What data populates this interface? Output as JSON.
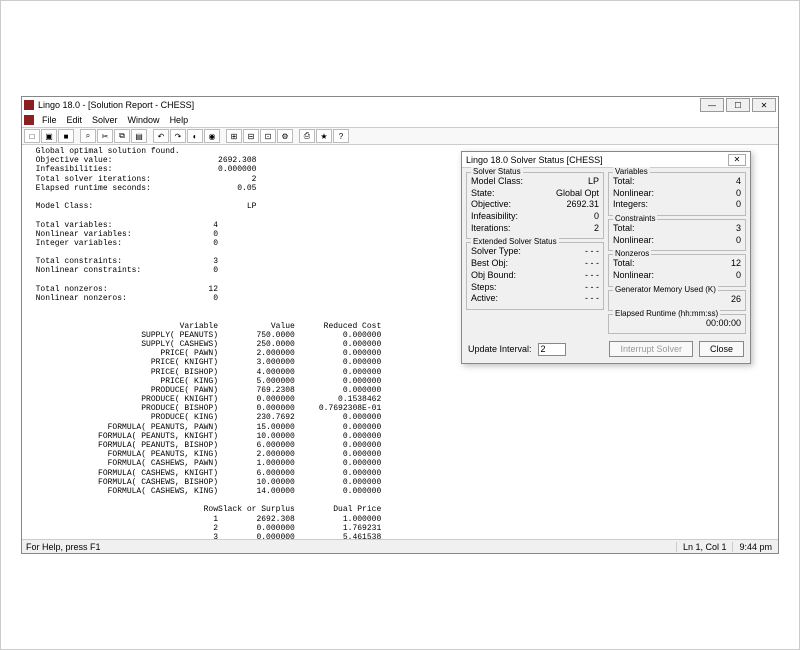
{
  "window": {
    "title": "Lingo 18.0 - [Solution Report - CHESS]",
    "min": "—",
    "max": "☐",
    "close": "✕"
  },
  "menu": [
    "File",
    "Edit",
    "Solver",
    "Window",
    "Help"
  ],
  "toolbar_icons": [
    "□",
    "▣",
    "■",
    "⌕",
    "✂",
    "⧉",
    "▤",
    "↶",
    "↷",
    "◐",
    "◉",
    "⊞",
    "⊟",
    "⊡",
    "⚙",
    "⎙",
    "★",
    "?"
  ],
  "status": {
    "help": "For Help, press F1",
    "pos": "Ln 1, Col 1",
    "time": "9:44 pm"
  },
  "report": {
    "header": "  Global optimal solution found.",
    "summary": [
      {
        "k": "  Objective value:",
        "v": "2692.308"
      },
      {
        "k": "  Infeasibilities:",
        "v": "0.000000"
      },
      {
        "k": "  Total solver iterations:",
        "v": "2"
      },
      {
        "k": "  Elapsed runtime seconds:",
        "v": "0.05"
      }
    ],
    "model_class_k": "  Model Class:",
    "model_class_v": "LP",
    "counts1": [
      {
        "k": "  Total variables:",
        "v": "4"
      },
      {
        "k": "  Nonlinear variables:",
        "v": "0"
      },
      {
        "k": "  Integer variables:",
        "v": "0"
      }
    ],
    "counts2": [
      {
        "k": "  Total constraints:",
        "v": "3"
      },
      {
        "k": "  Nonlinear constraints:",
        "v": "0"
      }
    ],
    "counts3": [
      {
        "k": "  Total nonzeros:",
        "v": "12"
      },
      {
        "k": "  Nonlinear nonzeros:",
        "v": "0"
      }
    ],
    "var_header": {
      "c1": "Variable",
      "c2": "Value",
      "c3": "Reduced Cost"
    },
    "vars": [
      {
        "n": "SUPPLY( PEANUTS)",
        "v": "750.0000",
        "r": "0.000000"
      },
      {
        "n": "SUPPLY( CASHEWS)",
        "v": "250.0000",
        "r": "0.000000"
      },
      {
        "n": "PRICE( PAWN)",
        "v": "2.000000",
        "r": "0.000000"
      },
      {
        "n": "PRICE( KNIGHT)",
        "v": "3.000000",
        "r": "0.000000"
      },
      {
        "n": "PRICE( BISHOP)",
        "v": "4.000000",
        "r": "0.000000"
      },
      {
        "n": "PRICE( KING)",
        "v": "5.000000",
        "r": "0.000000"
      },
      {
        "n": "PRODUCE( PAWN)",
        "v": "769.2308",
        "r": "0.000000"
      },
      {
        "n": "PRODUCE( KNIGHT)",
        "v": "0.000000",
        "r": "0.1538462"
      },
      {
        "n": "PRODUCE( BISHOP)",
        "v": "0.000000",
        "r": "0.7692308E-01"
      },
      {
        "n": "PRODUCE( KING)",
        "v": "230.7692",
        "r": "0.000000"
      },
      {
        "n": "FORMULA( PEANUTS, PAWN)",
        "v": "15.00000",
        "r": "0.000000"
      },
      {
        "n": "FORMULA( PEANUTS, KNIGHT)",
        "v": "10.00000",
        "r": "0.000000"
      },
      {
        "n": "FORMULA( PEANUTS, BISHOP)",
        "v": "6.000000",
        "r": "0.000000"
      },
      {
        "n": "FORMULA( PEANUTS, KING)",
        "v": "2.000000",
        "r": "0.000000"
      },
      {
        "n": "FORMULA( CASHEWS, PAWN)",
        "v": "1.000000",
        "r": "0.000000"
      },
      {
        "n": "FORMULA( CASHEWS, KNIGHT)",
        "v": "6.000000",
        "r": "0.000000"
      },
      {
        "n": "FORMULA( CASHEWS, BISHOP)",
        "v": "10.00000",
        "r": "0.000000"
      },
      {
        "n": "FORMULA( CASHEWS, KING)",
        "v": "14.00000",
        "r": "0.000000"
      }
    ],
    "row_header": {
      "c1": "Row",
      "c2": "Slack or Surplus",
      "c3": "Dual Price"
    },
    "rows": [
      {
        "n": "1",
        "v": "2692.308",
        "r": "1.000000"
      },
      {
        "n": "2",
        "v": "0.000000",
        "r": "1.769231"
      },
      {
        "n": "3",
        "v": "0.000000",
        "r": "5.461538"
      }
    ]
  },
  "dialog": {
    "title": "Lingo 18.0 Solver Status [CHESS]",
    "close": "✕",
    "solver_status_label": "Solver Status",
    "solver_status": [
      {
        "k": "Model Class:",
        "v": "LP"
      },
      {
        "k": "State:",
        "v": "Global Opt"
      },
      {
        "k": "Objective:",
        "v": "2692.31"
      },
      {
        "k": "Infeasibility:",
        "v": "0"
      },
      {
        "k": "Iterations:",
        "v": "2"
      }
    ],
    "ext_label": "Extended Solver Status",
    "ext": [
      {
        "k": "Solver Type:",
        "v": "- - -"
      },
      {
        "k": "Best Obj:",
        "v": "- - -"
      },
      {
        "k": "Obj Bound:",
        "v": "- - -"
      },
      {
        "k": "Steps:",
        "v": "- - -"
      },
      {
        "k": "Active:",
        "v": "- - -"
      }
    ],
    "vars_label": "Variables",
    "vars": [
      {
        "k": "Total:",
        "v": "4"
      },
      {
        "k": "Nonlinear:",
        "v": "0"
      },
      {
        "k": "Integers:",
        "v": "0"
      }
    ],
    "cons_label": "Constraints",
    "cons": [
      {
        "k": "Total:",
        "v": "3"
      },
      {
        "k": "Nonlinear:",
        "v": "0"
      }
    ],
    "nz_label": "Nonzeros",
    "nz": [
      {
        "k": "Total:",
        "v": "12"
      },
      {
        "k": "Nonlinear:",
        "v": "0"
      }
    ],
    "mem_label": "Generator Memory Used (K)",
    "mem_value": "26",
    "rt_label": "Elapsed Runtime (hh:mm:ss)",
    "rt_value": "00:00:00",
    "update_label": "Update Interval:",
    "update_value": "2",
    "interrupt": "Interrupt Solver",
    "close_btn": "Close"
  }
}
